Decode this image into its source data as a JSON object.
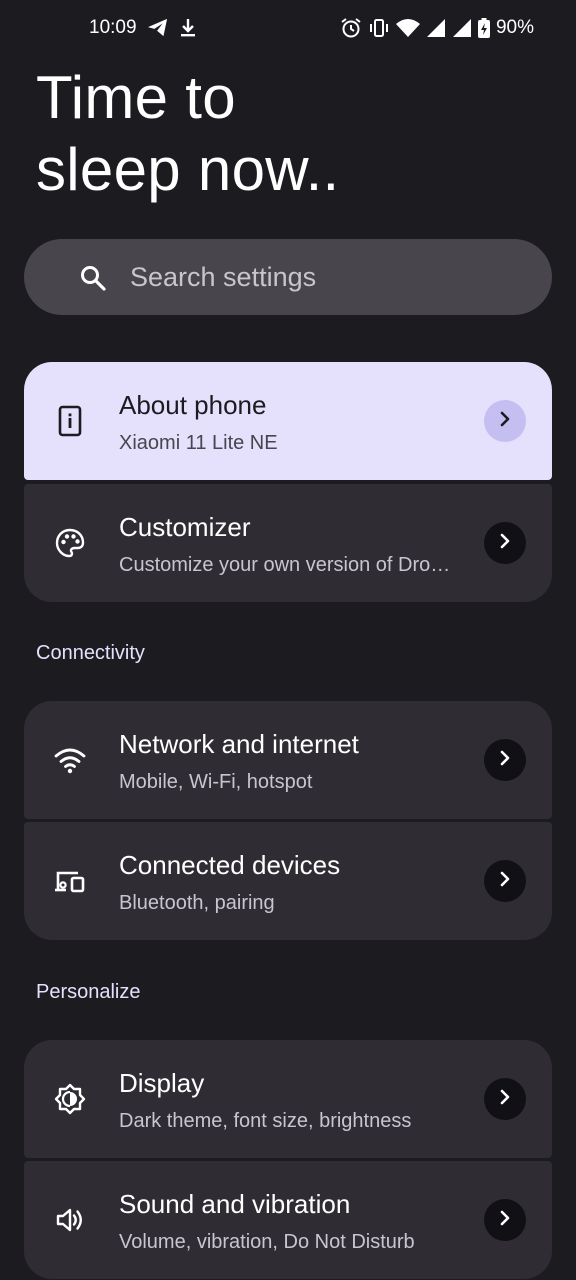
{
  "status_bar": {
    "time": "10:09",
    "battery": "90%",
    "icons_left": [
      "telegram-icon",
      "download-icon"
    ],
    "icons_right": [
      "alarm-icon",
      "vibrate-icon",
      "wifi-icon",
      "signal-icon",
      "signal-icon-2",
      "battery-icon"
    ]
  },
  "header": {
    "title_line1": "Time to",
    "title_line2": "sleep now.."
  },
  "search": {
    "placeholder": "Search settings"
  },
  "groups": {
    "top": [
      {
        "title": "About phone",
        "subtitle": "Xiaomi 11 Lite NE",
        "icon": "phone-info-icon"
      },
      {
        "title": "Customizer",
        "subtitle": "Customize your own version of Dro…",
        "icon": "palette-icon"
      }
    ],
    "connectivity": {
      "header": "Connectivity",
      "items": [
        {
          "title": "Network and internet",
          "subtitle": "Mobile, Wi-Fi, hotspot",
          "icon": "wifi-icon"
        },
        {
          "title": "Connected devices",
          "subtitle": "Bluetooth, pairing",
          "icon": "devices-icon"
        }
      ]
    },
    "personalize": {
      "header": "Personalize",
      "items": [
        {
          "title": "Display",
          "subtitle": "Dark theme, font size, brightness",
          "icon": "brightness-icon"
        },
        {
          "title": "Sound and vibration",
          "subtitle": "Volume, vibration, Do Not Disturb",
          "icon": "volume-icon"
        }
      ]
    }
  },
  "colors": {
    "background": "#1c1b20",
    "card": "#2f2d33",
    "highlight_card": "#e5e0fc",
    "search_bar": "#48464c",
    "accent_text": "#e5e0fc"
  }
}
